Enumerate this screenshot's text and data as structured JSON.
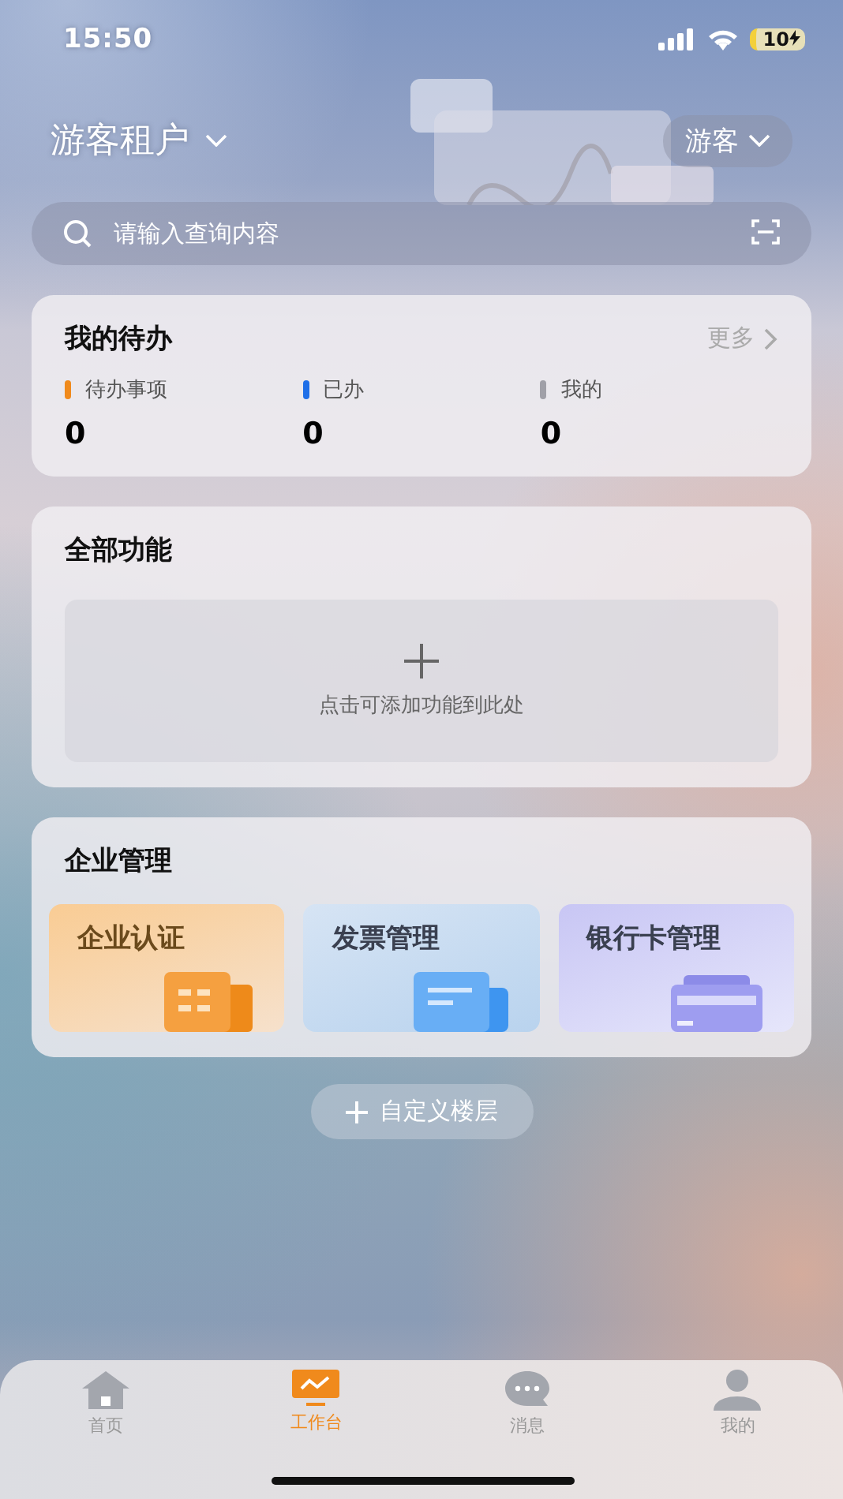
{
  "status_bar": {
    "time": "15:50",
    "battery": "10"
  },
  "header": {
    "tenant": "游客租户",
    "role": "游客"
  },
  "search": {
    "placeholder": "请输入查询内容"
  },
  "todo": {
    "title": "我的待办",
    "more": "更多",
    "stats": [
      {
        "label": "待办事项",
        "value": "0",
        "color": "#f08a1c"
      },
      {
        "label": "已办",
        "value": "0",
        "color": "#1f6fe8"
      },
      {
        "label": "我的",
        "value": "0",
        "color": "#a0a0a8"
      }
    ]
  },
  "functions": {
    "title": "全部功能",
    "add_hint": "点击可添加功能到此处"
  },
  "enterprise": {
    "title": "企业管理",
    "tiles": [
      {
        "label": "企业认证",
        "kind": "building"
      },
      {
        "label": "发票管理",
        "kind": "invoice"
      },
      {
        "label": "银行卡管理",
        "kind": "card"
      }
    ]
  },
  "custom_button": "自定义楼层",
  "tabs": [
    {
      "label": "首页",
      "kind": "home",
      "selected": false
    },
    {
      "label": "工作台",
      "kind": "workbench",
      "selected": true
    },
    {
      "label": "消息",
      "kind": "message",
      "selected": false
    },
    {
      "label": "我的",
      "kind": "profile",
      "selected": false
    }
  ]
}
